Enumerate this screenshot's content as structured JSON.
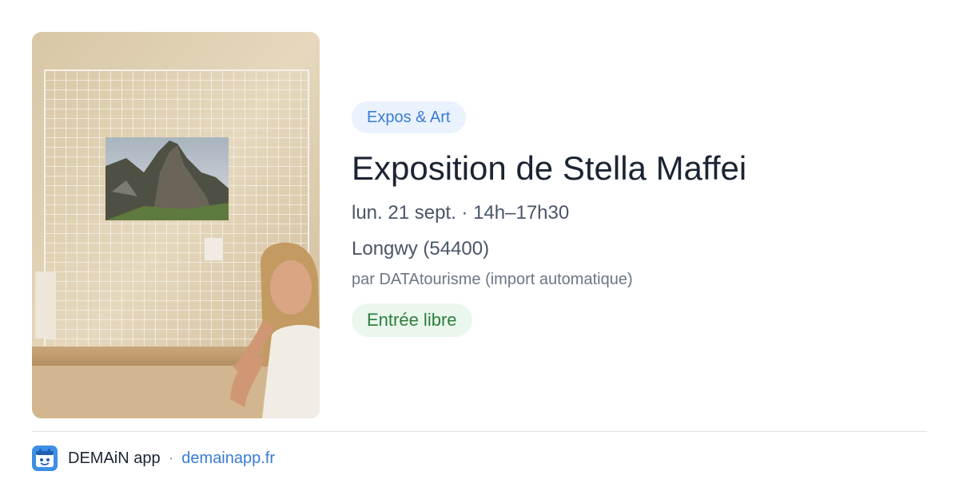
{
  "event": {
    "category": "Expos & Art",
    "title": "Exposition de Stella Maffei",
    "datetime": "lun. 21 sept. · 14h–17h30",
    "location": "Longwy (54400)",
    "source": "par DATAtourisme (import automatique)",
    "price": "Entrée libre"
  },
  "footer": {
    "app_name": "DEMAiN app",
    "separator": "·",
    "link": "demainapp.fr",
    "icon": "demain-app-logo-icon"
  },
  "colors": {
    "category_bg": "#eaf2fd",
    "category_text": "#3a7bd5",
    "price_bg": "#e9f7ed",
    "price_text": "#2e7d3e",
    "link": "#3a7bd5",
    "title": "#1b2433"
  }
}
